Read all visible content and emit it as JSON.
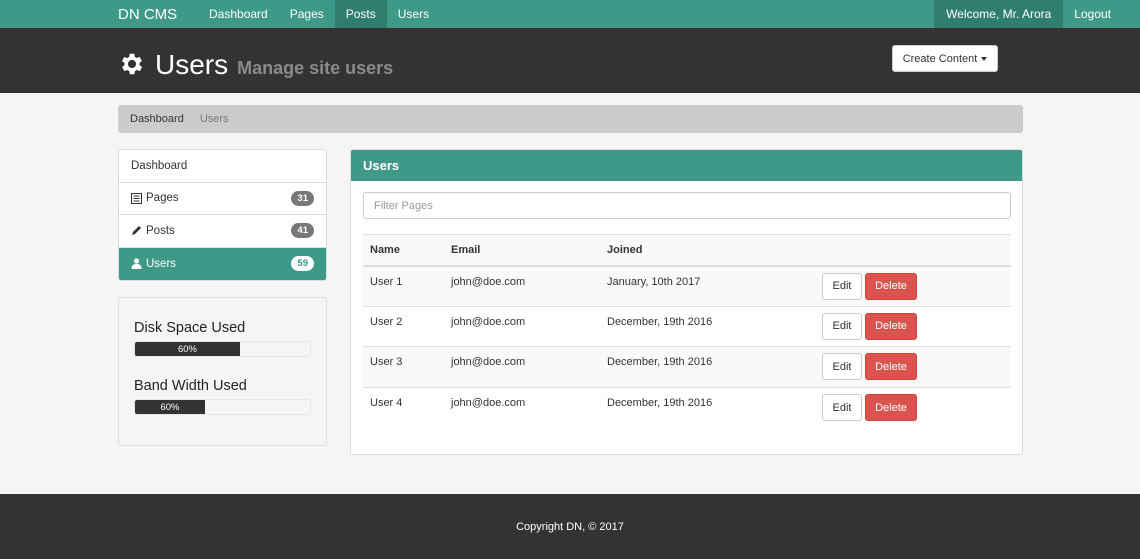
{
  "navbar": {
    "brand": "DN CMS",
    "items": [
      {
        "label": "Dashboard",
        "active": false
      },
      {
        "label": "Pages",
        "active": false
      },
      {
        "label": "Posts",
        "active": true
      },
      {
        "label": "Users",
        "active": false
      }
    ],
    "welcome": "Welcome, Mr. Arora",
    "logout": "Logout"
  },
  "header": {
    "icon": "gear-icon",
    "title": "Users",
    "subtitle": "Manage site users",
    "create_button": "Create Content"
  },
  "breadcrumb": {
    "items": [
      "Dashboard",
      "Users"
    ]
  },
  "sidebar": {
    "items": [
      {
        "label": "Dashboard",
        "icon": "",
        "badge": ""
      },
      {
        "label": "Pages",
        "icon": "list-alt-icon",
        "badge": "31"
      },
      {
        "label": "Posts",
        "icon": "pencil-icon",
        "badge": "41"
      },
      {
        "label": "Users",
        "icon": "user-icon",
        "badge": "59"
      }
    ],
    "stats": [
      {
        "title": "Disk Space Used",
        "label": "60%",
        "fraction": 0.6
      },
      {
        "title": "Band Width Used",
        "label": "60%",
        "fraction": 0.4
      }
    ]
  },
  "main": {
    "panel_title": "Users",
    "filter_placeholder": "Filter Pages",
    "columns": [
      "Name",
      "Email",
      "Joined"
    ],
    "rows": [
      {
        "name": "User 1",
        "email": "john@doe.com",
        "joined": "January, 10th 2017"
      },
      {
        "name": "User 2",
        "email": "john@doe.com",
        "joined": "December, 19th 2016"
      },
      {
        "name": "User 3",
        "email": "john@doe.com",
        "joined": "December, 19th 2016"
      },
      {
        "name": "User 4",
        "email": "john@doe.com",
        "joined": "December, 19th 2016"
      }
    ],
    "edit_label": "Edit",
    "delete_label": "Delete"
  },
  "footer": {
    "text": "Copyright DN, © 2017"
  },
  "colors": {
    "accent": "#3f9988",
    "dark": "#333333",
    "danger": "#d9534f"
  }
}
